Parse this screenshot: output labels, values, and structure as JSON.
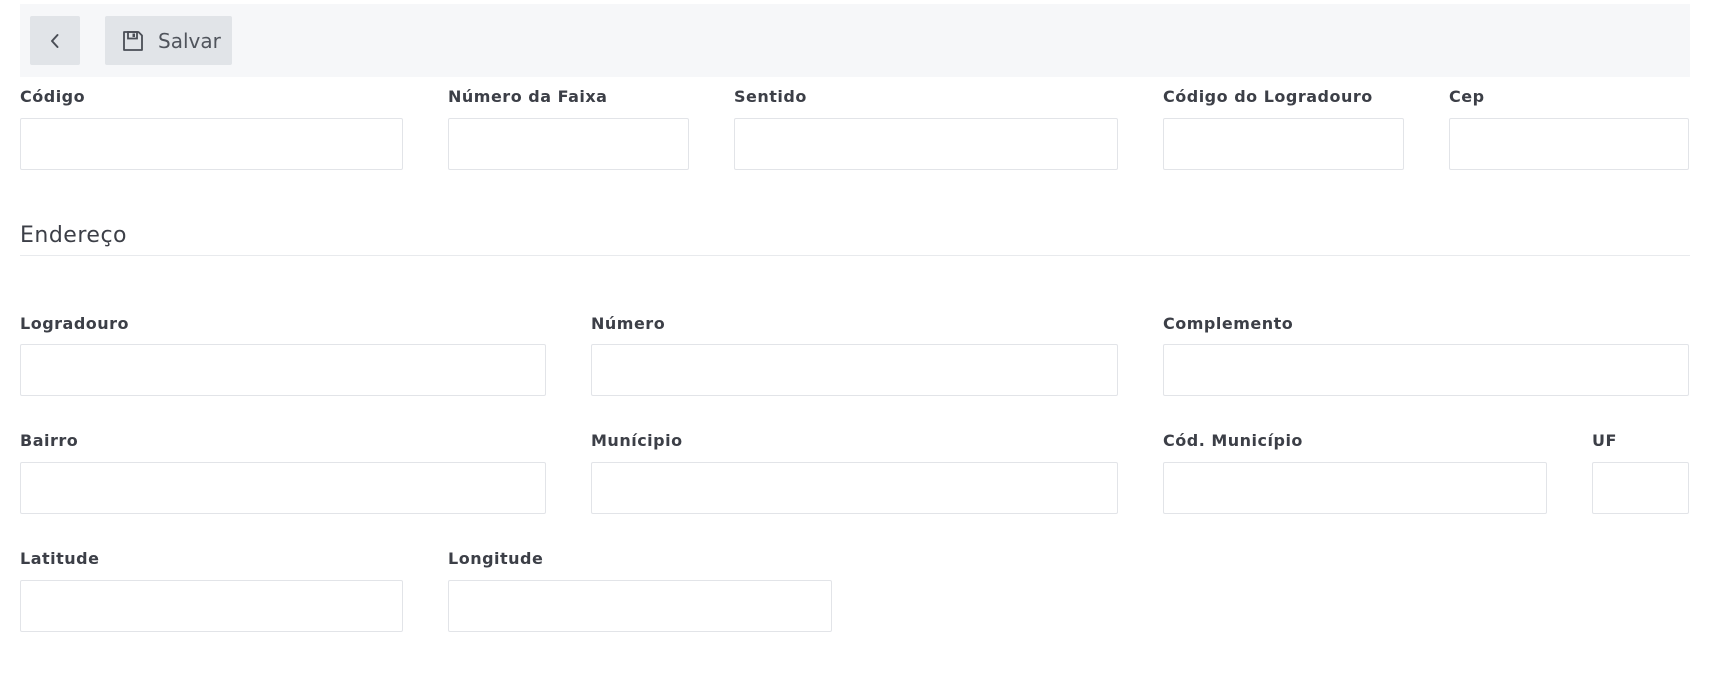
{
  "toolbar": {
    "back_icon": "chevron-left-icon",
    "save_icon": "floppy-disk-icon",
    "save_label": "Salvar"
  },
  "fields": {
    "codigo": {
      "label": "Código",
      "value": ""
    },
    "numero_faixa": {
      "label": "Número da Faixa",
      "value": ""
    },
    "sentido": {
      "label": "Sentido",
      "value": ""
    },
    "codigo_logradouro": {
      "label": "Código do Logradouro",
      "value": ""
    },
    "cep": {
      "label": "Cep",
      "value": ""
    }
  },
  "endereco": {
    "title": "Endereço",
    "logradouro": {
      "label": "Logradouro",
      "value": ""
    },
    "numero": {
      "label": "Número",
      "value": ""
    },
    "complemento": {
      "label": "Complemento",
      "value": ""
    },
    "bairro": {
      "label": "Bairro",
      "value": ""
    },
    "municipio": {
      "label": "Munícipio",
      "value": ""
    },
    "cod_municipio": {
      "label": "Cód. Município",
      "value": ""
    },
    "uf": {
      "label": "UF",
      "value": ""
    },
    "latitude": {
      "label": "Latitude",
      "value": ""
    },
    "longitude": {
      "label": "Longitude",
      "value": ""
    }
  }
}
